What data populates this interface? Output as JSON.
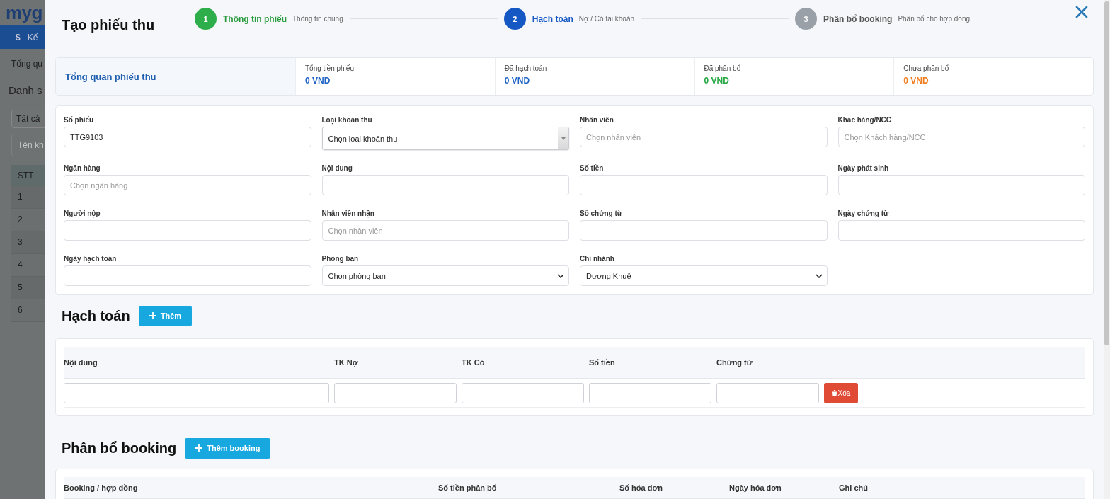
{
  "background": {
    "logo": "myg",
    "nav_icon": "$",
    "nav_item": "Kế",
    "tab": "Tổng qu",
    "heading": "Danh s",
    "filter": "Tất cả",
    "search_placeholder": "Tên kh",
    "table_header": "STT",
    "rows": [
      "1",
      "2",
      "3",
      "4",
      "5",
      "6"
    ]
  },
  "modal": {
    "title": "Tạo phiếu thu",
    "steps": [
      {
        "number": "1",
        "title": "Thông tin phiếu",
        "subtitle": "Thông tin chung",
        "completed": true,
        "selected": false
      },
      {
        "number": "2",
        "title": "Hạch toán",
        "subtitle": "Nợ / Có tài khoản",
        "completed": false,
        "selected": true
      },
      {
        "number": "3",
        "title": "Phân bổ booking",
        "subtitle": "Phân bổ cho hợp đồng",
        "completed": false,
        "selected": false
      }
    ],
    "summary": {
      "title": "Tổng quan phiếu thu",
      "stats": [
        {
          "label": "Tổng tiền phiếu",
          "value": "0 VND",
          "color": "#1f63c6"
        },
        {
          "label": "Đã hạch toán",
          "value": "0 VND",
          "color": "#1f63c6"
        },
        {
          "label": "Đã phân bổ",
          "value": "0 VND",
          "color": "#27a844"
        },
        {
          "label": "Chưa phân bổ",
          "value": "0 VND",
          "color": "#f07c1e"
        }
      ]
    },
    "fields": [
      {
        "label": "Số phiếu",
        "kind": "input",
        "value": "TTG9103"
      },
      {
        "label": "Loại khoản thu",
        "kind": "combo",
        "value": "Chọn loại khoản thu"
      },
      {
        "label": "Nhân viên",
        "kind": "input",
        "placeholder": "Chọn nhân viên"
      },
      {
        "label": "Khác hàng/NCC",
        "kind": "input",
        "placeholder": "Chọn Khách hàng/NCC"
      },
      {
        "label": "Ngân hàng",
        "kind": "input",
        "placeholder": "Chọn ngân hàng"
      },
      {
        "label": "Nội dung",
        "kind": "input"
      },
      {
        "label": "Số tiền",
        "kind": "input"
      },
      {
        "label": "Ngày phát sinh",
        "kind": "input"
      },
      {
        "label": "Người nộp",
        "kind": "input"
      },
      {
        "label": "Nhân viên nhận",
        "kind": "input",
        "placeholder": "Chọn nhân viên"
      },
      {
        "label": "Số chứng từ",
        "kind": "input"
      },
      {
        "label": "Ngày chứng từ",
        "kind": "input"
      },
      {
        "label": "Ngày hạch toán",
        "kind": "input"
      },
      {
        "label": "Phòng ban",
        "kind": "select",
        "value": "Chọn phòng ban"
      },
      {
        "label": "Chi nhánh",
        "kind": "select",
        "value": "Dương Khuê"
      }
    ],
    "accounting": {
      "title": "Hạch toán",
      "add_button": "Thêm",
      "columns": [
        "Nội dung",
        "TK Nợ",
        "TK Có",
        "Số tiền",
        "Chứng từ"
      ],
      "delete_button": "Xóa"
    },
    "booking": {
      "title": "Phân bổ booking",
      "add_button": "Thêm booking",
      "columns": [
        "Booking / hợp đồng",
        "Số tiền phân bổ",
        "Số hóa đơn",
        "Ngày hóa đơn",
        "Ghi chú"
      ]
    }
  }
}
